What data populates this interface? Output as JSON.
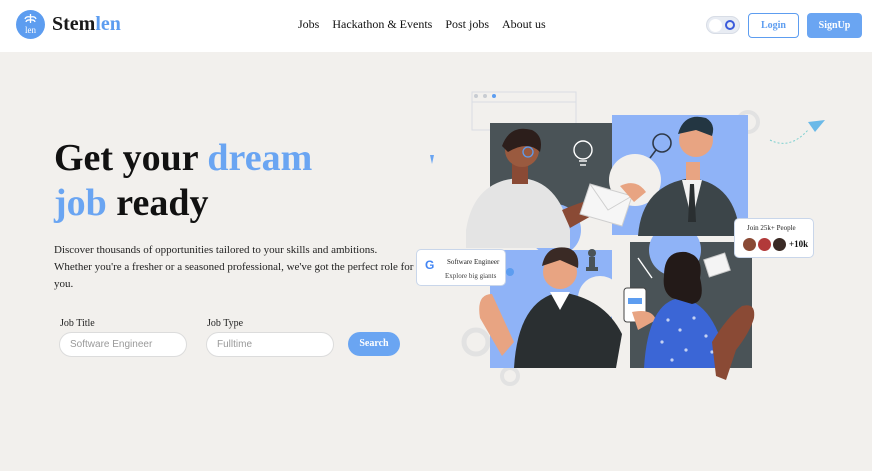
{
  "brand": {
    "logo_text": "len",
    "name_start": "Stem",
    "name_end": "len"
  },
  "nav": {
    "links": [
      "Jobs",
      "Hackathon & Events",
      "Post jobs",
      "About us"
    ]
  },
  "header_actions": {
    "login": "Login",
    "signup": "SignUp"
  },
  "hero": {
    "headline_part1": "Get your ",
    "headline_part2": "dream",
    "headline_part3": "job",
    "headline_part4": " ready",
    "description": "Discover thousands of opportunities tailored to your skills and ambitions. Whether you're a fresher or a seasoned professional, we've got the perfect role for you."
  },
  "search": {
    "job_title_label": "Job Title",
    "job_title_placeholder": "Software Engineer",
    "job_type_label": "Job Type",
    "job_type_placeholder": "Fulltime",
    "button": "Search"
  },
  "cards": {
    "google_letter": "G",
    "role_title": "Software Engineer",
    "role_sub": "Explore big giants",
    "join_text": "Join 25k+ People",
    "join_count": "+10k"
  },
  "colors": {
    "accent": "#6aa5f2",
    "background": "#f2f0ed",
    "panel_dark": "#4a5357",
    "panel_blue": "#8fb3f7"
  }
}
